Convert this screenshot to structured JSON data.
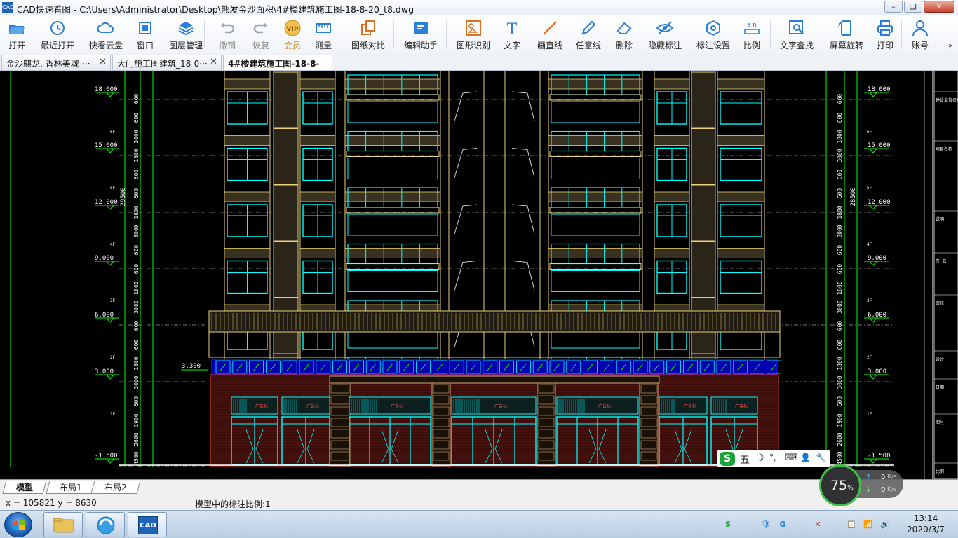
{
  "window": {
    "title": "CAD快速看图 - C:\\Users\\Administrator\\Desktop\\熊发金沙面积\\4#楼建筑施工图-18-8-20_t8.dwg",
    "app_icon_label": "CAD",
    "buttons": [
      "minimize",
      "maximize",
      "close"
    ]
  },
  "toolbar": {
    "items": [
      {
        "label": "打开",
        "icon": "folder-open-icon"
      },
      {
        "label": "最近打开",
        "icon": "recent-clock-icon"
      },
      {
        "label": "快看云盘",
        "icon": "cloud-icon"
      },
      {
        "label": "窗口",
        "icon": "window-icon"
      },
      {
        "label": "图层管理",
        "icon": "layers-icon"
      },
      {
        "label": "撤销",
        "icon": "undo-icon",
        "disabled": true
      },
      {
        "label": "恢复",
        "icon": "redo-icon",
        "disabled": true
      },
      {
        "label": "会员",
        "icon": "vip-icon",
        "vip": true
      },
      {
        "label": "测量",
        "icon": "measure-icon"
      },
      {
        "label": "图纸对比",
        "icon": "compare-icon"
      },
      {
        "label": "编辑助手",
        "icon": "edit-assistant-icon"
      },
      {
        "label": "图形识别",
        "icon": "shape-recognition-icon"
      },
      {
        "label": "文字",
        "icon": "text-icon"
      },
      {
        "label": "画直线",
        "icon": "line-icon"
      },
      {
        "label": "任意线",
        "icon": "pencil-icon"
      },
      {
        "label": "删除",
        "icon": "eraser-icon"
      },
      {
        "label": "隐藏标注",
        "icon": "eye-hide-icon"
      },
      {
        "label": "标注设置",
        "icon": "annotation-settings-icon"
      },
      {
        "label": "比例",
        "icon": "scale-icon"
      },
      {
        "label": "文字查找",
        "icon": "text-search-icon"
      },
      {
        "label": "屏幕旋转",
        "icon": "rotate-screen-icon"
      },
      {
        "label": "打印",
        "icon": "printer-icon"
      },
      {
        "label": "账号",
        "icon": "user-icon"
      }
    ],
    "more_glyph": "»",
    "vip_glyph": "VIP",
    "text_glyph": "T",
    "scale_glyph": "A:B"
  },
  "tabs": [
    {
      "label": "金沙麒龙. 香林美域-··· ",
      "active": false
    },
    {
      "label": "大门施工图建筑_18-0···",
      "active": false
    },
    {
      "label": "4#楼建筑施工图-18-8-",
      "active": true
    }
  ],
  "tab_close_glyph": "✕",
  "drawing": {
    "colors": {
      "cyan": "#00ffff",
      "yellow": "#e8d37a",
      "green": "#00ff00",
      "blue": "#1010ff",
      "red": "#c0302a",
      "white": "#ffffff",
      "gray": "#9a9a9a"
    },
    "elevation_labels": [
      "18.000",
      "15.000",
      "12.000",
      "9.000",
      "6.000",
      "3.000",
      "-1.500"
    ],
    "floor_tags": [
      "6F",
      "5F",
      "4F",
      "3F",
      "2F",
      "1F"
    ],
    "left_dimensions": [
      "600",
      "600",
      "3000",
      "1800",
      "600",
      "600",
      "1800",
      "3000",
      "600",
      "600",
      "1800",
      "3000",
      "600",
      "600",
      "1800",
      "3000",
      "600",
      "1900",
      "2600",
      "4500",
      "29500"
    ],
    "right_dimensions": [
      "600",
      "600",
      "1800",
      "3000",
      "600",
      "600",
      "1800",
      "3000",
      "600",
      "600",
      "1800",
      "3000",
      "600",
      "600",
      "1800",
      "3000",
      "600",
      "1900",
      "2600",
      "4500",
      "28500"
    ],
    "canopy_level": "3.300",
    "shop_label": "广告标",
    "right_panel_texts": [
      "建设单位名称",
      "项目名称",
      "说明",
      "签 名",
      "审核",
      "设计",
      "日期",
      "图号",
      "比例"
    ]
  },
  "layout_tabs": [
    {
      "label": "模型",
      "active": true
    },
    {
      "label": "布局1",
      "active": false
    },
    {
      "label": "布局2",
      "active": false
    }
  ],
  "status": {
    "coords": "x = 105821  y = 8630",
    "scale_text": "模型中的标注比例:1"
  },
  "ime": {
    "logo": "S",
    "mode": "五",
    "items": [
      "☽",
      "°,",
      "⌨",
      "👤",
      "🔧"
    ]
  },
  "net_widget": {
    "percent": "75",
    "percent_unit": "%",
    "upload": "0",
    "download": "0",
    "unit": "K/s",
    "up_arrow": "↑",
    "down_arrow": "↓"
  },
  "taskbar": {
    "time": "13:14",
    "date": "2020/3/7",
    "cad_label": "CAD",
    "tray_glyphs": [
      "S",
      "🛡",
      "G",
      "✕",
      "📋",
      "📶",
      "🔊"
    ]
  }
}
